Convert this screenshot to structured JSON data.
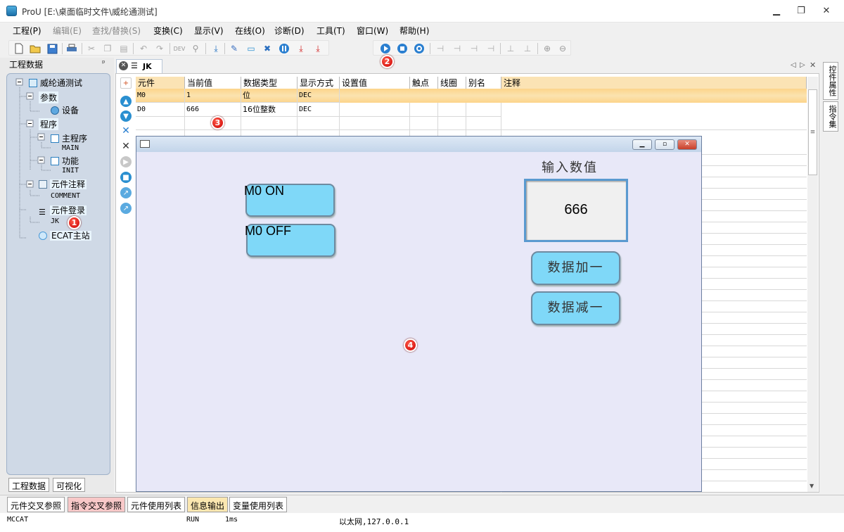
{
  "window": {
    "title": "ProU [E:\\桌面临时文件\\威纶通测试]",
    "minimize": "▁",
    "restore": "❐",
    "close": "✕"
  },
  "menu": [
    {
      "label": "工程(P)",
      "disabled": false
    },
    {
      "label": "编辑(E)",
      "disabled": true
    },
    {
      "label": "查找/替换(S)",
      "disabled": true
    },
    {
      "label": "变换(C)",
      "disabled": false
    },
    {
      "label": "显示(V)",
      "disabled": false
    },
    {
      "label": "在线(O)",
      "disabled": false
    },
    {
      "label": "诊断(D)",
      "disabled": false
    },
    {
      "label": "工具(T)",
      "disabled": false
    },
    {
      "label": "窗口(W)",
      "disabled": false
    },
    {
      "label": "帮助(H)",
      "disabled": false
    }
  ],
  "left_panel": {
    "title": "工程数据",
    "pin": "ᵖ",
    "tree": {
      "root": "威纶通测试",
      "params": "参数",
      "device": "设备",
      "program": "程序",
      "main_program": "主程序",
      "main": "MAIN",
      "function": "功能",
      "init": "INIT",
      "comment_group": "元件注释",
      "comment": "COMMENT",
      "register_group": "元件登录",
      "jk": "JK",
      "ecat": "ECAT主站"
    },
    "tabs": [
      "工程数据",
      "可视化"
    ]
  },
  "document": {
    "tab_label": "JK",
    "nav": {
      "prev": "◁",
      "next": "▷",
      "close": "✕"
    },
    "columns": [
      "元件",
      "当前值",
      "数据类型",
      "显示方式",
      "设置值",
      "触点",
      "线圈",
      "别名",
      "注释"
    ],
    "rows": [
      [
        "M0",
        "1",
        "位",
        "DEC",
        "",
        "",
        "",
        "",
        ""
      ],
      [
        "D0",
        "666",
        "16位整数",
        "DEC",
        "",
        "",
        "",
        "",
        ""
      ]
    ]
  },
  "right_tabs": [
    "控件属性",
    "指令集"
  ],
  "hmi": {
    "btn_on": "M0 ON",
    "btn_off": "M0 OFF",
    "input_label": "输入数值",
    "input_value": "666",
    "btn_inc": "数据加一",
    "btn_dec": "数据减一"
  },
  "badges": [
    "1",
    "2",
    "3",
    "4"
  ],
  "bottom_tabs": [
    {
      "label": "元件交叉参照",
      "color": "#ffffff"
    },
    {
      "label": "指令交叉参照",
      "color": "#f8c8c8"
    },
    {
      "label": "元件使用列表",
      "color": "#ffffff"
    },
    {
      "label": "信息输出",
      "color": "#fbe7b0"
    },
    {
      "label": "变量使用列表",
      "color": "#ffffff"
    }
  ],
  "status": {
    "plc": "MCCAT",
    "mode": "RUN",
    "scan": "1ms",
    "conn": "以太网,127.0.0.1"
  }
}
